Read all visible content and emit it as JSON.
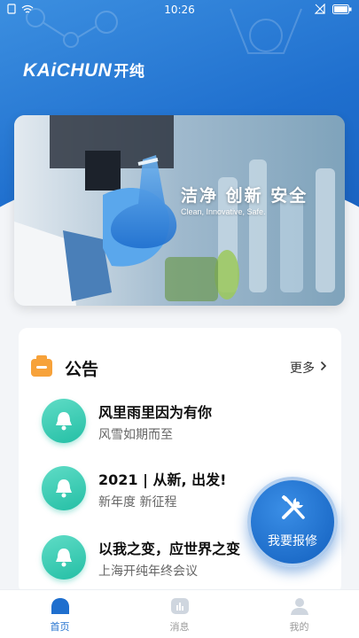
{
  "status_bar": {
    "time": "10:26"
  },
  "brand": {
    "logo_en": "KAiCHUN",
    "logo_cn": "开纯"
  },
  "banner": {
    "title": "洁净  创新  安全",
    "subtitle": "Clean, Innovative, Safe."
  },
  "announcements": {
    "title": "公告",
    "more_label": "更多",
    "items": [
      {
        "title": "风里雨里因为有你",
        "subtitle": "风雪如期而至"
      },
      {
        "title": "2021 | 从新, 出发!",
        "subtitle": "新年度 新征程"
      },
      {
        "title": "以我之变，应世界之变",
        "subtitle": "上海开纯年终会议"
      }
    ]
  },
  "fab": {
    "label": "我要报修"
  },
  "tabbar": {
    "tabs": [
      {
        "label": "首页",
        "icon": "home-icon",
        "active": true
      },
      {
        "label": "消息",
        "icon": "message-icon",
        "active": false
      },
      {
        "label": "我的",
        "icon": "profile-icon",
        "active": false
      }
    ]
  },
  "colors": {
    "primary": "#1f6fce",
    "notice_icon": "#24bfa5",
    "tab_inactive": "#999999"
  }
}
